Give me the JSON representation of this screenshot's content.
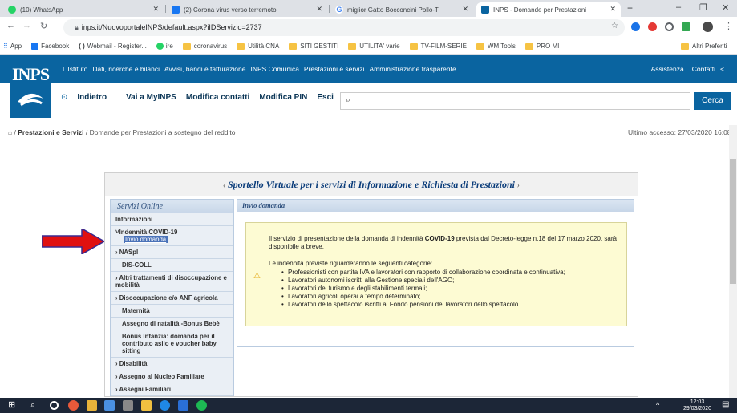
{
  "browser": {
    "tabs": [
      {
        "label": "(10) WhatsApp",
        "color": "#25d366"
      },
      {
        "label": "(2) Corona virus verso terremoto",
        "color": "#1877f2"
      },
      {
        "label": "miglior Gatto Bocconcini Pollo-T",
        "color": "#4285f4"
      },
      {
        "label": "INPS - Domande per Prestazioni",
        "color": "#0a64a0"
      }
    ],
    "new_tab": "+",
    "url": "inps.it/NuovoportaleINPS/default.aspx?iIDServizio=2737",
    "bookmarks": [
      "App",
      "Facebook",
      "Webmail - Register...",
      "ire",
      "coronavirus",
      "Utilità CNA",
      "SITI GESTITI",
      "UTILITA' varie",
      "TV-FILM-SERIE",
      "WM Tools",
      "PRO MI"
    ],
    "bookmarks_other": "Altri Preferiti"
  },
  "inps": {
    "logo": "INPS",
    "nav": [
      "L'Istituto",
      "Dati, ricerche e bilanci",
      "Avvisi, bandi e fatturazione",
      "INPS Comunica",
      "Prestazioni e servizi",
      "Amministrazione trasparente"
    ],
    "assistance": "Assistenza",
    "contacts": "Contatti",
    "back": "Indietro",
    "subnav": [
      "Vai a MyINPS",
      "Modifica contatti",
      "Modifica PIN",
      "Esci"
    ],
    "search_button": "Cerca"
  },
  "breadcrumb": {
    "home_icon": "home-icon",
    "sep": "/",
    "level1": "Prestazioni e Servizi",
    "level2": "Domande per Prestazioni a sostegno del reddito"
  },
  "last_access": "Ultimo accesso: 27/03/2020 16:08",
  "sportello": {
    "title": "Sportello Virtuale per i servizi di Informazione e Richiesta di Prestazioni",
    "sidebar_title": "Servizi Online",
    "items": [
      "Informazioni",
      "Indennità COVID-19",
      "NASpI",
      "DIS-COLL",
      "Altri trattamenti di disoccupazione e mobilità",
      "Disoccupazione e/o ANF agricola",
      "Maternità",
      "Assegno di natalità -Bonus Bebè",
      "Bonus Infanzia: domanda per il contributo asilo e voucher baby sitting",
      "Disabilità",
      "Assegno al Nucleo Familiare",
      "Assegni Familiari"
    ],
    "subitem": "Invio domanda",
    "main_title": "Invio domanda",
    "notice_p1a": "Il servizio di presentazione della domanda di indennità ",
    "notice_p1b": "COVID-19",
    "notice_p1c": " prevista dal Decreto-legge n.18 del 17 marzo 2020, sarà disponibile a breve.",
    "notice_p2": "Le indennità previste riguarderanno le seguenti categorie:",
    "categories": [
      "Professionisti con partita IVA e lavoratori con rapporto di collaborazione coordinata e continuativa;",
      "Lavoratori autonomi iscritti alla Gestione speciali dell'AGO;",
      "Lavoratori del turismo e degli stabilimenti termali;",
      "Lavoratori agricoli operai a tempo determinato;",
      "Lavoratori dello spettacolo iscritti al Fondo pensioni dei lavoratori dello spettacolo."
    ]
  },
  "taskbar": {
    "time": "12:03",
    "date": "29/03/2020"
  }
}
